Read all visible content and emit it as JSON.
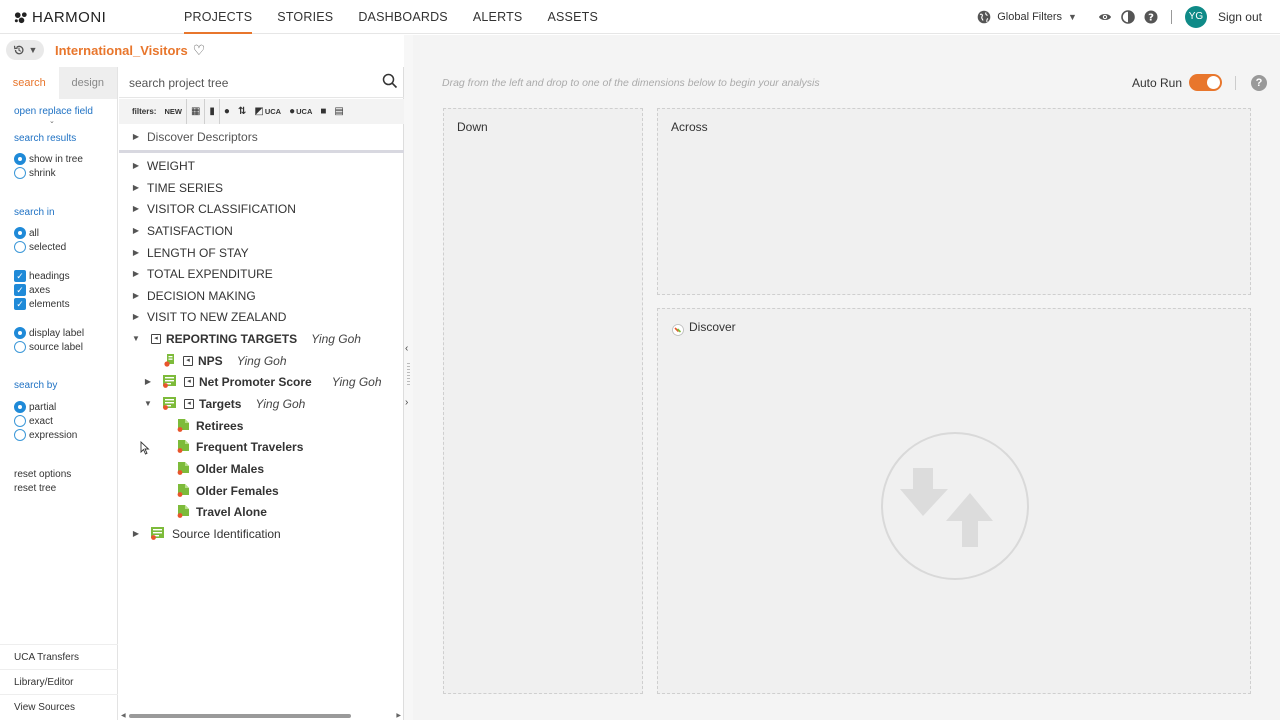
{
  "brand": {
    "name": "HARMONI"
  },
  "nav": {
    "items": [
      {
        "label": "PROJECTS",
        "active": true
      },
      {
        "label": "STORIES",
        "active": false
      },
      {
        "label": "DASHBOARDS",
        "active": false
      },
      {
        "label": "ALERTS",
        "active": false
      },
      {
        "label": "ASSETS",
        "active": false
      }
    ]
  },
  "topright": {
    "global_filters_label": "Global Filters",
    "avatar_initials": "YG",
    "signout_label": "Sign out"
  },
  "project": {
    "name": "International_Visitors"
  },
  "options_panel": {
    "tabs": [
      {
        "label": "search",
        "active": true
      },
      {
        "label": "design",
        "active": false
      }
    ],
    "open_replace_field": "open replace field",
    "search_results_heading": "search results",
    "show_in_tree": "show in tree",
    "shrink": "shrink",
    "search_in_heading": "search in",
    "all": "all",
    "selected": "selected",
    "headings": "headings",
    "axes": "axes",
    "elements": "elements",
    "display_label": "display label",
    "source_label": "source label",
    "search_by_heading": "search by",
    "partial": "partial",
    "exact": "exact",
    "expression": "expression",
    "reset_options": "reset options",
    "reset_tree": "reset tree",
    "bottom_links": [
      "UCA Transfers",
      "Library/Editor",
      "View Sources"
    ]
  },
  "tree_panel": {
    "search_placeholder": "search project tree",
    "filters_label": "filters:",
    "filter_new": "NEW",
    "filter_uca1": "UCA",
    "filter_uca2": "UCA",
    "rows": [
      {
        "label": "Discover Descriptors",
        "author": ""
      },
      {
        "label": "WEIGHT",
        "author": ""
      },
      {
        "label": "TIME SERIES",
        "author": ""
      },
      {
        "label": "VISITOR CLASSIFICATION",
        "author": ""
      },
      {
        "label": "SATISFACTION",
        "author": ""
      },
      {
        "label": "LENGTH OF STAY",
        "author": ""
      },
      {
        "label": "TOTAL EXPENDITURE",
        "author": ""
      },
      {
        "label": "DECISION MAKING",
        "author": ""
      },
      {
        "label": "VISIT TO NEW ZEALAND",
        "author": ""
      },
      {
        "label": "REPORTING TARGETS",
        "author": "Ying Goh"
      },
      {
        "label": "NPS",
        "author": "Ying Goh"
      },
      {
        "label": "Net Promoter Score",
        "author": "Ying Goh"
      },
      {
        "label": "Targets",
        "author": "Ying Goh"
      },
      {
        "label": "Retirees",
        "author": ""
      },
      {
        "label": "Frequent Travelers",
        "author": ""
      },
      {
        "label": "Older Males",
        "author": ""
      },
      {
        "label": "Older Females",
        "author": ""
      },
      {
        "label": "Travel Alone",
        "author": ""
      },
      {
        "label": "Source Identification",
        "author": ""
      }
    ]
  },
  "canvas": {
    "hint": "Drag from the left and drop to one of the dimensions below to begin your analysis",
    "auto_run_label": "Auto Run",
    "auto_run_on": true,
    "zones": {
      "down": "Down",
      "across": "Across",
      "discover": "Discover"
    }
  },
  "colors": {
    "accent": "#e8762c",
    "link": "#1f72c4",
    "avatar": "#0f8a87",
    "element_green": "#7dbb3a"
  },
  "icons": [
    "history-icon",
    "heart-icon",
    "globe-icon",
    "eye-icon",
    "contrast-icon",
    "help-icon",
    "search-icon",
    "expand-triangle-icon",
    "collapse-triangle-icon",
    "variable-icon",
    "discover-icon",
    "pivot-arrows-icon"
  ]
}
